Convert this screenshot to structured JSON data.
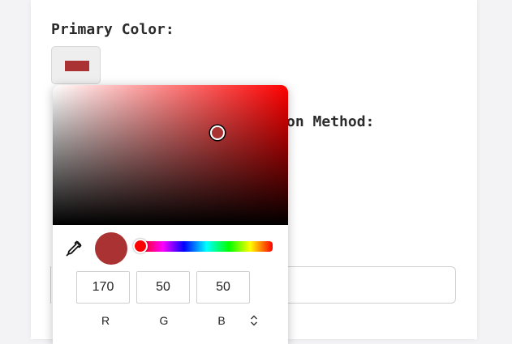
{
  "form": {
    "primary_color_label": "Primary Color:",
    "method_label_partial": "on Method:"
  },
  "colors": {
    "selected": "#aa3232",
    "pure_hue": "#ff0000"
  },
  "picker": {
    "rgb": {
      "r": "170",
      "g": "50",
      "b": "50"
    },
    "labels": {
      "r": "R",
      "g": "G",
      "b": "B"
    },
    "mode_toggle_icon": "up-down-chevron-icon",
    "eyedropper_icon": "eyedropper-icon",
    "hue_value": 0
  }
}
